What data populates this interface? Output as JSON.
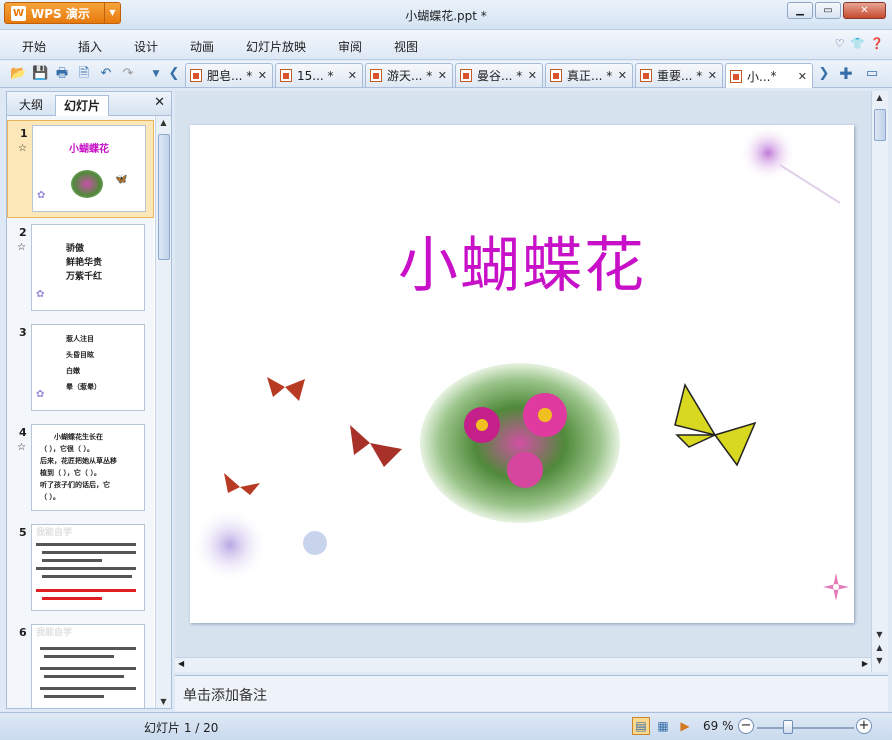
{
  "app": {
    "button_label": "WPS 演示",
    "doc_title": "小蝴蝶花.ppt *"
  },
  "menu": [
    "开始",
    "插入",
    "设计",
    "动画",
    "幻灯片放映",
    "审阅",
    "视图"
  ],
  "doc_tabs": [
    {
      "label": "肥皂...",
      "modified": "*"
    },
    {
      "label": "15...",
      "modified": "*"
    },
    {
      "label": "游天...",
      "modified": "*"
    },
    {
      "label": "曼谷...",
      "modified": "*"
    },
    {
      "label": "真正...",
      "modified": "*"
    },
    {
      "label": "重要...",
      "modified": "*"
    },
    {
      "label": "小...",
      "modified": "*"
    }
  ],
  "left_pane": {
    "tab_outline": "大纲",
    "tab_slides": "幻灯片"
  },
  "thumbnails": [
    {
      "num": "1",
      "title": "小蝴蝶花"
    },
    {
      "num": "2",
      "lines": [
        "骄傲",
        "鲜艳华贵",
        "万紫千红"
      ]
    },
    {
      "num": "3",
      "lines": [
        "惹人注目",
        "头昏目眩",
        "白嫩",
        "晕（惹晕）"
      ]
    },
    {
      "num": "4",
      "lines": [
        "小蝴蝶花生长在",
        "（   ），它很（    ）。",
        "后来，花匠把她从草丛移",
        "植到（  ），它（   ）。",
        "听了孩子们的话后，它",
        "（   ）。"
      ]
    },
    {
      "num": "5",
      "heading": "我能自学"
    },
    {
      "num": "6",
      "heading": "我能自学"
    }
  ],
  "slide": {
    "title": "小蝴蝶花"
  },
  "notes_placeholder": "单击添加备注",
  "status": {
    "slide_indicator": "幻灯片 1 / 20",
    "zoom": "69 %"
  }
}
